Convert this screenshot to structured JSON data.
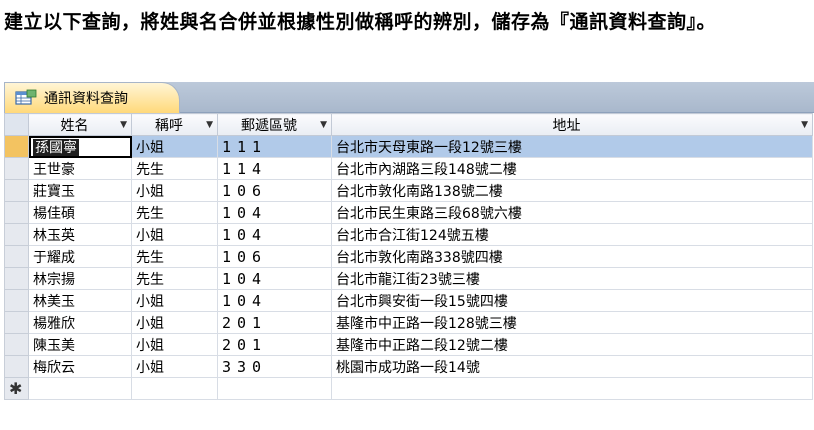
{
  "instruction": "建立以下查詢，將姓與名合併並根據性別做稱呼的辨別，儲存為『通訊資料查詢』。",
  "tab": {
    "label": "通訊資料查詢"
  },
  "columns": [
    "姓名",
    "稱呼",
    "郵遞區號",
    "地址"
  ],
  "rows": [
    {
      "name": "孫國寧",
      "title": "小姐",
      "zip": "111",
      "address": "台北市天母東路一段12號三樓"
    },
    {
      "name": "王世豪",
      "title": "先生",
      "zip": "114",
      "address": "台北市內湖路三段148號二樓"
    },
    {
      "name": "莊寶玉",
      "title": "小姐",
      "zip": "106",
      "address": "台北市敦化南路138號二樓"
    },
    {
      "name": "楊佳碩",
      "title": "先生",
      "zip": "104",
      "address": "台北市民生東路三段68號六樓"
    },
    {
      "name": "林玉英",
      "title": "小姐",
      "zip": "104",
      "address": "台北市合江街124號五樓"
    },
    {
      "name": "于耀成",
      "title": "先生",
      "zip": "106",
      "address": "台北市敦化南路338號四樓"
    },
    {
      "name": "林宗揚",
      "title": "先生",
      "zip": "104",
      "address": "台北市龍江街23號三樓"
    },
    {
      "name": "林美玉",
      "title": "小姐",
      "zip": "104",
      "address": "台北市興安街一段15號四樓"
    },
    {
      "name": "楊雅欣",
      "title": "小姐",
      "zip": "201",
      "address": "基隆市中正路一段128號三樓"
    },
    {
      "name": "陳玉美",
      "title": "小姐",
      "zip": "201",
      "address": "基隆市中正路二段12號二樓"
    },
    {
      "name": "梅欣云",
      "title": "小姐",
      "zip": "330",
      "address": "桃園市成功路一段14號"
    }
  ],
  "new_record_marker": "✱",
  "colors": {
    "tab_bg": "#ffd97a",
    "selected_row": "#b1cae9",
    "record_selector_current": "#f3c361"
  }
}
